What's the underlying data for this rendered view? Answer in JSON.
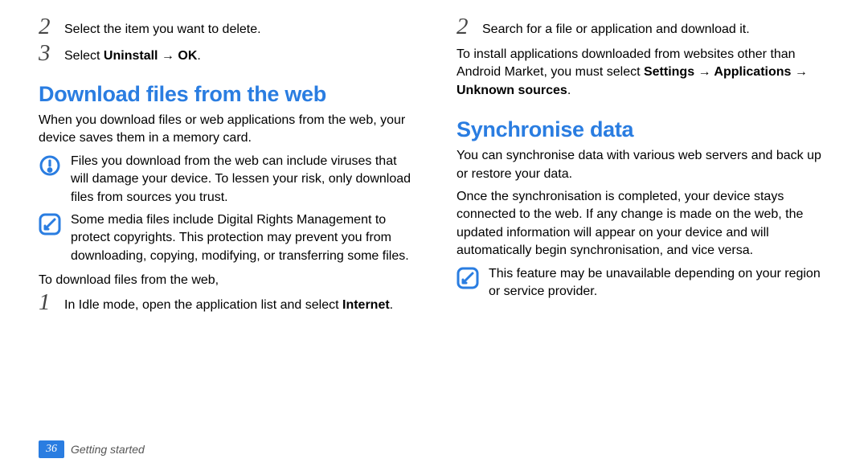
{
  "left": {
    "step2_num": "2",
    "step2_text": "Select the item you want to delete.",
    "step3_num": "3",
    "step3_text_prefix": "Select ",
    "step3_bold": "Uninstall → OK",
    "step3_suffix": ".",
    "heading1": "Download files from the web",
    "para1": "When you download files or web applications from the web, your device saves them in a memory card.",
    "warn_text": "Files you download from the web can include viruses that will damage your device. To lessen your risk, only download files from sources you trust.",
    "info_text": "Some media files include Digital Rights Management to protect copyrights. This protection may prevent you from downloading, copying, modifying, or transferring some files.",
    "para2": "To download files from the web,",
    "step1_num": "1",
    "step1_text_prefix": "In Idle mode, open the application list and select ",
    "step1_bold": "Internet",
    "step1_suffix": "."
  },
  "right": {
    "step2_num": "2",
    "step2_text": "Search for a file or application and download it.",
    "para1_prefix": "To install applications downloaded from websites other than Android Market, you must select ",
    "para1_bold": "Settings → Applications → Unknown sources",
    "para1_suffix": ".",
    "heading1": "Synchronise data",
    "para2": "You can synchronise data with various web servers and back up or restore your data.",
    "para3": "Once the synchronisation is completed, your device stays connected to the web. If any change is made on the web, the updated information will appear on your device and will automatically begin synchronisation, and vice versa.",
    "info_text": "This feature may be unavailable depending on your region or service provider."
  },
  "footer": {
    "page_num": "36",
    "section": "Getting started"
  }
}
